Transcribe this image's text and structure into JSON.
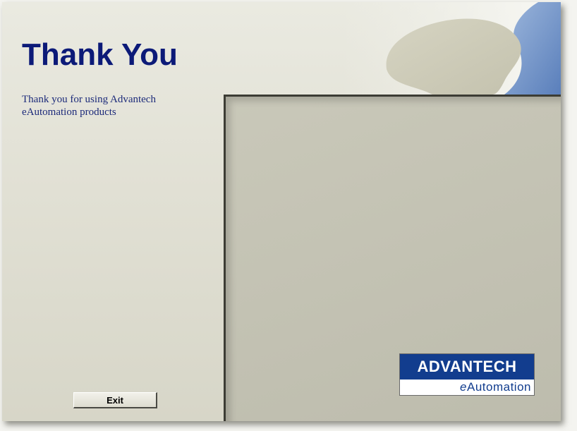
{
  "screen": {
    "title": "Thank You",
    "message_lines": [
      "Thank you for using Advantech",
      "eAutomation products"
    ]
  },
  "buttons": {
    "exit_label": "Exit"
  },
  "logo": {
    "brand_text": "ADVANTECH",
    "tagline": "eAutomation"
  },
  "colors": {
    "title_text": "#0c1a78",
    "message_text": "#1c2a7a",
    "logo_blue": "#123d8e",
    "corner_accent_blue": "#6f92c6",
    "panel_fill": "#c6c5b6",
    "background": "#e4e3d8"
  }
}
